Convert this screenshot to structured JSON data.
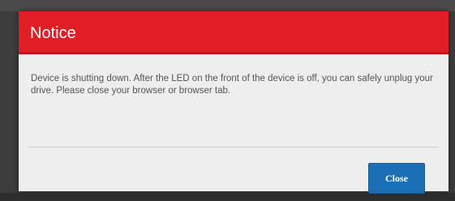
{
  "dialog": {
    "title": "Notice",
    "message": "Device is shutting down. After the LED on the front of the device is off, you can safely unplug your drive. Please close your browser or browser tab.",
    "close_label": "Close"
  },
  "colors": {
    "header": "#e21d25",
    "button": "#1a6fb4",
    "body": "#eeeeee",
    "backdrop": "#3c3c3c"
  }
}
